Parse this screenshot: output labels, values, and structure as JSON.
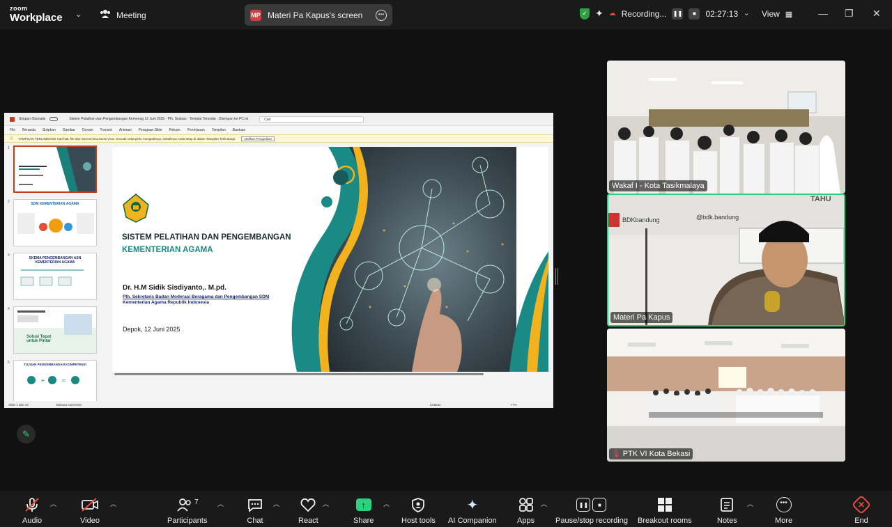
{
  "app": {
    "brand_top": "zoom",
    "brand_bottom": "Workplace",
    "meeting_label": "Meeting"
  },
  "screen_share": {
    "initials": "MP",
    "label": "Materi Pa Kapus's screen"
  },
  "recording": {
    "label": "Recording...",
    "timer": "02:27:13"
  },
  "view": {
    "label": "View"
  },
  "powerpoint": {
    "autosave": "Simpan Otomatis",
    "doc_title": "Sistem Pelatihan dan Pengembangan Kemenag 12 Juni 2025 · Plh. Sesban · Templat Tersedia · Disimpan ke PC ini",
    "search": "Cari",
    "menu": [
      "File",
      "Beranda",
      "Sisipkan",
      "Gambar",
      "Desain",
      "Transisi",
      "Animasi",
      "Peragaan Slide",
      "Rekam",
      "Peninjauan",
      "Tampilan",
      "Bantuan"
    ],
    "warning": "TAMPILAN TERLINDUNGI  Hati-hati, file dari internet bisa berisi virus. Kecuali Anda perlu mengeditnya, sebaiknya Anda tetap di dalam Tampilan Terlindungi.",
    "warning_button": "Aktifkan Pengeditan",
    "status_left": "Slide 1 dari 15",
    "status_lang": "Bahasa Indonesia",
    "status_notes": "Catatan",
    "zoom": "77%"
  },
  "slide": {
    "title1": "SISTEM PELATIHAN DAN PENGEMBANGAN",
    "title2": "KEMENTERIAN AGAMA",
    "name": "Dr. H.M Sidik Sisdiyanto,. M.pd.",
    "role1": "Plh. Sekretaris Badan Moderasi Beragama dan Pengembangan SDM",
    "role2": "Kementerian Agama Republik Indonesia",
    "date": "Depok, 12 Juni 2025"
  },
  "thumbnails": [
    {
      "num": "1",
      "caption": ""
    },
    {
      "num": "2",
      "caption": "SDM KEMENTERIAN AGAMA"
    },
    {
      "num": "3",
      "caption": "SKEMA PENGEMBANGAN ASN KEMENTERIAN AGAMA"
    },
    {
      "num": "4",
      "caption": "Solusi Tepat untuk Pintar"
    },
    {
      "num": "5",
      "caption": "TUJUAN PENGEMBANGAN KOMPETENSI"
    }
  ],
  "participants_tiles": [
    {
      "name": "Wakaf I - Kota Tasikmalaya",
      "muted": false
    },
    {
      "name": "Materi Pa Kapus",
      "muted": false
    },
    {
      "name": "PTK VI Kota Bekasi",
      "muted": true
    }
  ],
  "tile2_text": {
    "brand": "BDKbandung",
    "social": "@bdk.bandung",
    "banner": "TAHU"
  },
  "toolbar": {
    "audio": "Audio",
    "video": "Video",
    "participants": "Participants",
    "participants_count": "7",
    "chat": "Chat",
    "react": "React",
    "share": "Share",
    "host_tools": "Host tools",
    "ai_companion": "AI Companion",
    "apps": "Apps",
    "pause_recording": "Pause/stop recording",
    "breakout": "Breakout rooms",
    "notes": "Notes",
    "more": "More",
    "end": "End"
  },
  "colors": {
    "accent_green": "#2bd17e",
    "end_red": "#e74c3c",
    "teal": "#1a8a86"
  }
}
